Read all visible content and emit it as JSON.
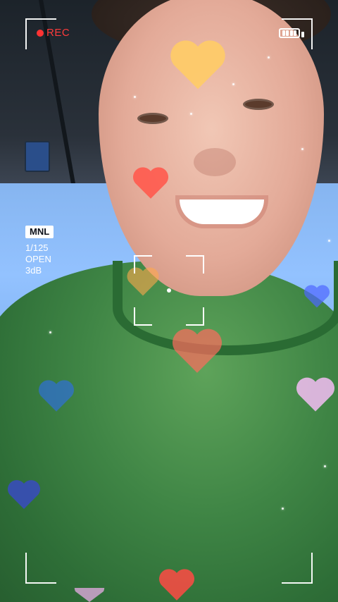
{
  "camera_ui": {
    "rec_label": "REC",
    "mode_badge": "MNL",
    "shutter_speed": "1/125",
    "aperture_label": "OPEN",
    "audio_level": "3dB",
    "battery_icon": "battery-icon",
    "rec_dot_color": "#ff3333"
  },
  "effects": {
    "hearts": [
      {
        "name": "heart-top-orange",
        "color": "#ffcc66",
        "opacity": 0.9
      },
      {
        "name": "heart-red-mid",
        "color": "#ff5a4e",
        "opacity": 0.9
      },
      {
        "name": "heart-orange-focus",
        "color": "#ffa94d",
        "opacity": 0.6
      },
      {
        "name": "heart-red-neck",
        "color": "#ff6b5e",
        "opacity": 0.7
      },
      {
        "name": "heart-blue-right",
        "color": "#4e66ff",
        "opacity": 0.7
      },
      {
        "name": "heart-blue-left",
        "color": "#2f6fd8",
        "opacity": 0.7
      },
      {
        "name": "heart-pink-right",
        "color": "#ffc0ff",
        "opacity": 0.8
      },
      {
        "name": "heart-navy-bottom-left",
        "color": "#3a49c9",
        "opacity": 0.8
      },
      {
        "name": "heart-red-bottom",
        "color": "#ff4a44",
        "opacity": 0.85
      },
      {
        "name": "heart-pink-bottom",
        "color": "#f5b0f2",
        "opacity": 0.7
      }
    ]
  }
}
